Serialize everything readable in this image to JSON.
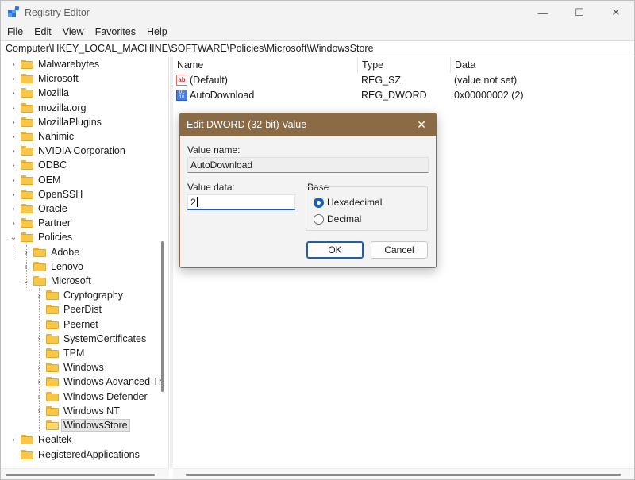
{
  "window": {
    "title": "Registry Editor",
    "minimize_glyph": "—",
    "maximize_glyph": "☐",
    "close_glyph": "✕"
  },
  "menu": [
    "File",
    "Edit",
    "View",
    "Favorites",
    "Help"
  ],
  "address": "Computer\\HKEY_LOCAL_MACHINE\\SOFTWARE\\Policies\\Microsoft\\WindowsStore",
  "tree": {
    "level1": [
      {
        "label": "Malwarebytes"
      },
      {
        "label": "Microsoft"
      },
      {
        "label": "Mozilla"
      },
      {
        "label": "mozilla.org"
      },
      {
        "label": "MozillaPlugins"
      },
      {
        "label": "Nahimic"
      },
      {
        "label": "NVIDIA Corporation"
      },
      {
        "label": "ODBC"
      },
      {
        "label": "OEM"
      },
      {
        "label": "OpenSSH"
      },
      {
        "label": "Oracle"
      },
      {
        "label": "Partner"
      },
      {
        "label": "Policies"
      }
    ],
    "policies_children": [
      "Adobe",
      "Lenovo",
      "Microsoft"
    ],
    "microsoft_children": [
      "Cryptography",
      "PeerDist",
      "Peernet",
      "SystemCertificates",
      "TPM",
      "Windows",
      "Windows Advanced Th",
      "Windows Defender",
      "Windows NT",
      "WindowsStore"
    ],
    "after": [
      "Realtek",
      "RegisteredApplications"
    ],
    "selected": "WindowsStore"
  },
  "list": {
    "columns": [
      "Name",
      "Type",
      "Data"
    ],
    "rows": [
      {
        "name": "(Default)",
        "type": "REG_SZ",
        "data": "(value not set)",
        "icon": "string-value-icon"
      },
      {
        "name": "AutoDownload",
        "type": "REG_DWORD",
        "data": "0x00000002 (2)",
        "icon": "dword-value-icon"
      }
    ]
  },
  "dialog": {
    "title": "Edit DWORD (32-bit) Value",
    "close_glyph": "✕",
    "value_name_label": "Value name:",
    "value_name": "AutoDownload",
    "value_data_label": "Value data:",
    "value_data": "2",
    "base_label": "Base",
    "base_options": [
      "Hexadecimal",
      "Decimal"
    ],
    "base_selected": "Hexadecimal",
    "ok_label": "OK",
    "cancel_label": "Cancel"
  },
  "colors": {
    "dialog_titlebar": "#8b6a46",
    "accent": "#1a5fb4",
    "folder": "#f7c64a"
  }
}
